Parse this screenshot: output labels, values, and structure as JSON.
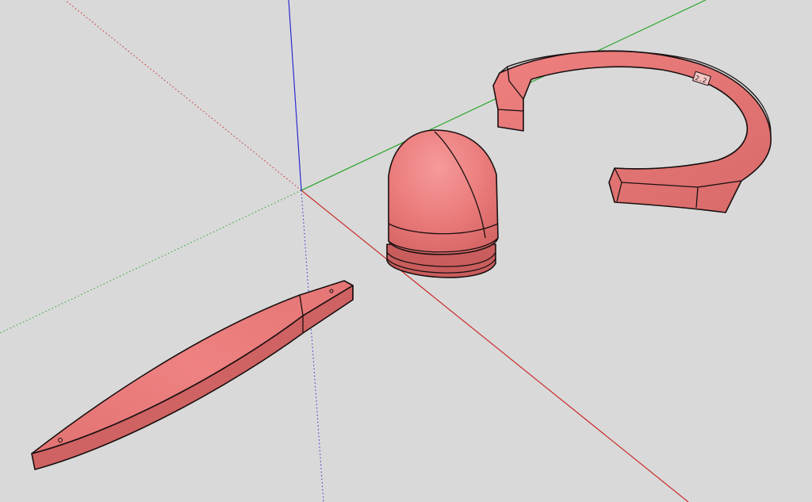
{
  "viewport": {
    "background_color": "#d9d9d9"
  },
  "axes": {
    "red": "#cc2a2a",
    "green": "#2aa52a",
    "blue": "#2b2bd4"
  },
  "model": {
    "face_color": "#e77777",
    "face_light": "#f28a8a",
    "face_dark": "#c95d5d",
    "edge_color": "#1a1010"
  },
  "ring_label": "2.2"
}
